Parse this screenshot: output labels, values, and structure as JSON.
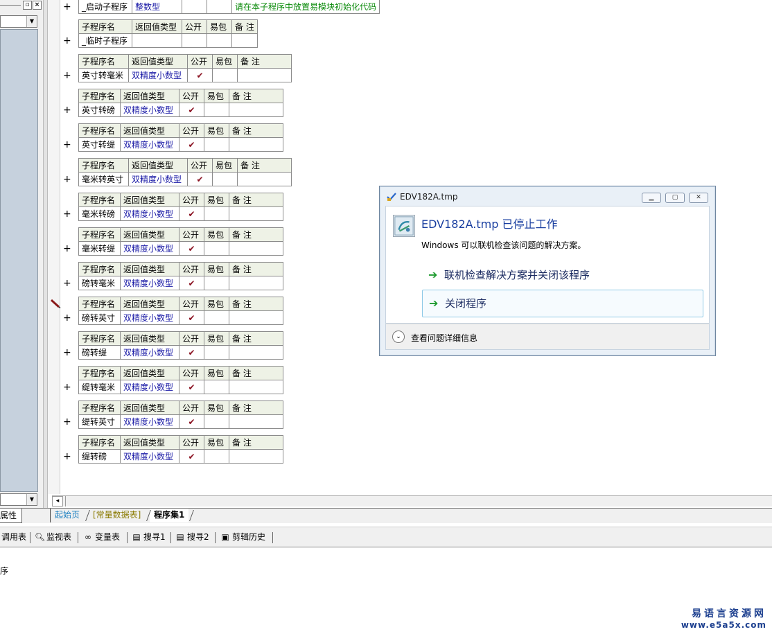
{
  "window_controls": {
    "restore": "▫",
    "close": "×"
  },
  "table_headers": [
    "子程序名",
    "返回值类型",
    "公开",
    "易包",
    "备 注"
  ],
  "startup_row": {
    "name": "_启动子程序",
    "type": "整数型",
    "note": "请在本子程序中放置易模块初始化代码"
  },
  "subroutines": [
    {
      "name": "_临时子程序",
      "type": "",
      "public": ""
    },
    {
      "name": "英寸转毫米",
      "type": "双精度小数型",
      "public": "✔"
    },
    {
      "name": "英寸转磅",
      "type": "双精度小数型",
      "public": "✔"
    },
    {
      "name": "英寸转缇",
      "type": "双精度小数型",
      "public": "✔"
    },
    {
      "name": "毫米转英寸",
      "type": "双精度小数型",
      "public": "✔"
    },
    {
      "name": "毫米转磅",
      "type": "双精度小数型",
      "public": "✔"
    },
    {
      "name": "毫米转缇",
      "type": "双精度小数型",
      "public": "✔"
    },
    {
      "name": "磅转毫米",
      "type": "双精度小数型",
      "public": "✔"
    },
    {
      "name": "磅转英寸",
      "type": "双精度小数型",
      "public": "✔"
    },
    {
      "name": "磅转缇",
      "type": "双精度小数型",
      "public": "✔"
    },
    {
      "name": "缇转毫米",
      "type": "双精度小数型",
      "public": "✔"
    },
    {
      "name": "缇转英寸",
      "type": "双精度小数型",
      "public": "✔"
    },
    {
      "name": "缇转磅",
      "type": "双精度小数型",
      "public": "✔"
    }
  ],
  "plus_symbol": "+",
  "bottom_tabs": {
    "properties": "属性",
    "start_page": "起始页",
    "constants": "[常量数据表]",
    "program_set": "程序集1"
  },
  "toolbar": {
    "call_table": "调用表",
    "watch_table": "监视表",
    "var_table": "变量表",
    "search1": "搜寻1",
    "search2": "搜寻2",
    "clip_history": "剪辑历史"
  },
  "output": {
    "text": "序"
  },
  "watermark": {
    "line1": "易语言资源网",
    "line2": "www.e5a5x.com"
  },
  "dialog": {
    "title": "EDV182A.tmp",
    "heading": "EDV182A.tmp 已停止工作",
    "description": "Windows 可以联机检查该问题的解决方案。",
    "option1": "联机检查解决方案并关闭该程序",
    "option2": "关闭程序",
    "details": "查看问题详细信息",
    "arrow": "➔",
    "chevron": "⌄"
  },
  "colors": {
    "type_blue": "#1a1aa6",
    "check_red": "#8a1020",
    "note_green": "#0a8a0a",
    "link_blue": "#1a3fa0"
  }
}
